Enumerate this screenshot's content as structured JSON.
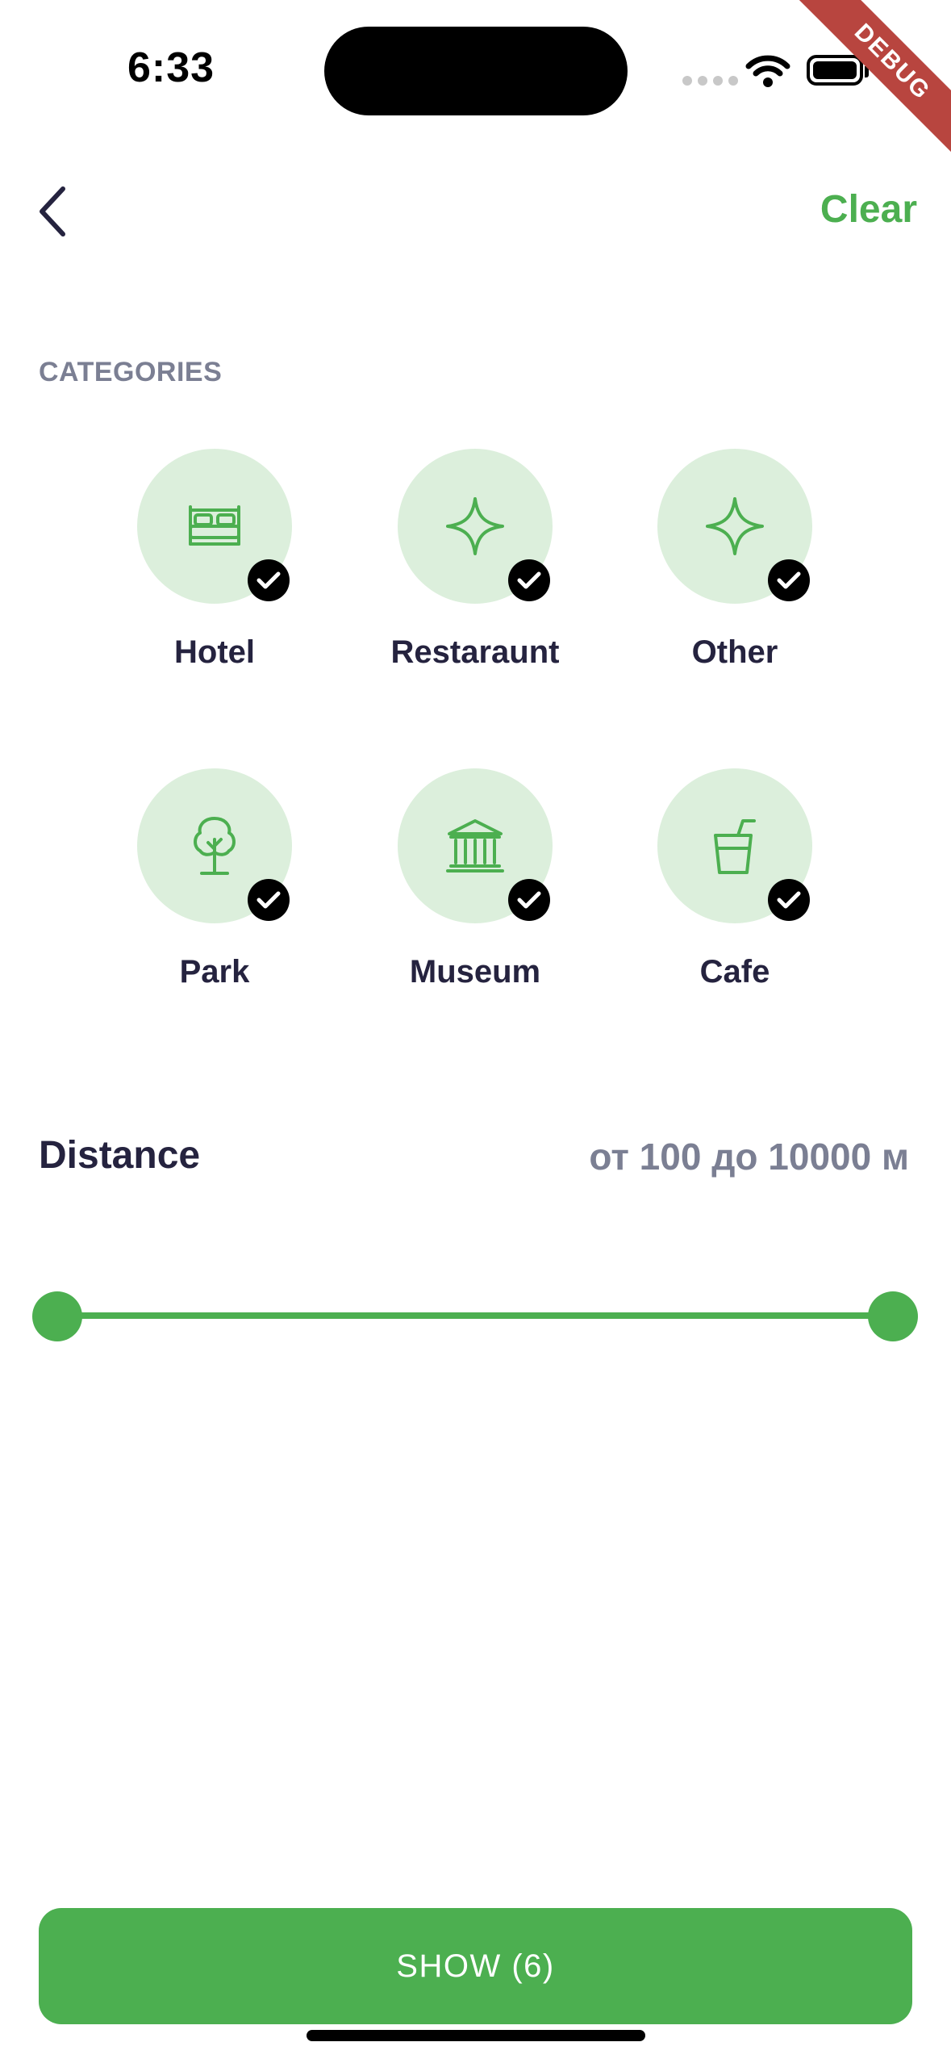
{
  "status_bar": {
    "time": "6:33"
  },
  "debug_banner": "DEBUG",
  "header": {
    "clear_label": "Clear"
  },
  "categories": {
    "title": "CATEGORIES",
    "items": [
      {
        "label": "Hotel",
        "icon": "bed-icon",
        "selected": true
      },
      {
        "label": "Restaraunt",
        "icon": "sparkle-icon",
        "selected": true
      },
      {
        "label": "Other",
        "icon": "sparkle-icon",
        "selected": true
      },
      {
        "label": "Park",
        "icon": "tree-icon",
        "selected": true
      },
      {
        "label": "Museum",
        "icon": "museum-icon",
        "selected": true
      },
      {
        "label": "Cafe",
        "icon": "drink-icon",
        "selected": true
      }
    ]
  },
  "distance": {
    "label": "Distance",
    "value_text": "от 100 до 10000 м",
    "min": 100,
    "max": 10000,
    "selected_min": 100,
    "selected_max": 10000
  },
  "show_button": {
    "label": "SHOW (6)"
  },
  "colors": {
    "accent": "#4caf50",
    "category_bg": "#dcefdc",
    "text_primary": "#25233f",
    "text_secondary": "#7b7f93",
    "ribbon": "#b8453f"
  }
}
